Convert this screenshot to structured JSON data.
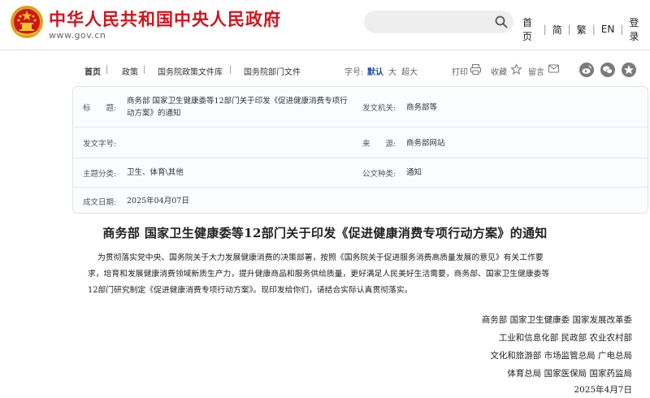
{
  "header": {
    "site_title": "中华人民共和国中央人民政府",
    "site_url": "www.gov.cn",
    "search_placeholder": "",
    "nav": [
      "首页",
      "简",
      "繁",
      "EN",
      "登录"
    ]
  },
  "breadcrumb": {
    "items": [
      "首页",
      "政策",
      "国务院政策文件库",
      "国务院部门文件"
    ],
    "font_label": "字号:",
    "font_sizes": [
      "默认",
      "大",
      "超大"
    ],
    "active_font_size": "默认",
    "print_label": "打印",
    "favorite_label": "收藏",
    "notes_label": "留言"
  },
  "info": {
    "title_label": "标　　题:",
    "title_value_line1": "商务部  国家卫生健康委等12部门关于印发《促进健康消费专项行",
    "title_value_line2": "动方案》的通知",
    "issuer_label": "发文机关:",
    "issuer_value": "商务部等",
    "doc_no_label": "发文字号:",
    "doc_no_value": "",
    "source_label": "来　　源:",
    "source_value": "商务部网站",
    "category_label": "主题分类:",
    "category_value": "卫生、体育\\其他",
    "doc_type_label": "公文种类:",
    "doc_type_value": "通知",
    "date_label": "成文日期:",
    "date_value": "2025年04月07日"
  },
  "article": {
    "title": "商务部  国家卫生健康委等12部门关于印发《促进健康消费专项行动方案》的通知",
    "body_lines": [
      "为贯彻落实党中央、国务院关于大力发展健康消费的决策部署，按照《国务院关于促进服务消费高质量发展的意见》有关工作要",
      "求，培育和发展健康消费领域新质生产力，提升健康商品和服务供给质量，更好满足人民美好生活需要，商务部、国家卫生健康委等",
      "12部门研究制定《促进健康消费专项行动方案》。现印发给你们，请结合实际认真贯彻落实。"
    ],
    "signatures": [
      "商务部  国家卫生健康委  国家发展改革委",
      "工业和信息化部  民政部  农业农村部",
      "文化和旅游部  市场监管总局  广电总局",
      "体育总局  国家医保局  国家药监局",
      "2025年4月7日"
    ]
  },
  "colors": {
    "brand_red": "#d0141c",
    "active_blue": "#1d4fa3"
  }
}
